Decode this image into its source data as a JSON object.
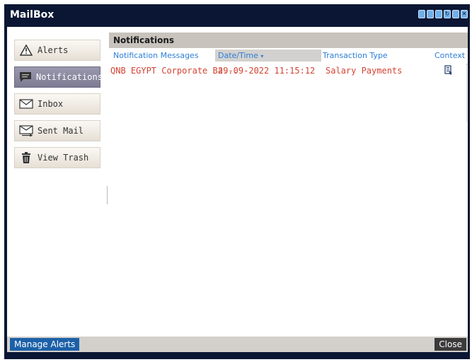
{
  "window": {
    "title": "MailBox"
  },
  "titlebar_icons": [
    "window-icon",
    "window-icon",
    "window-icon",
    "refresh-icon",
    "window-icon",
    "close-icon"
  ],
  "sidebar": {
    "items": [
      {
        "label": "Alerts",
        "icon": "warning-icon",
        "active": false
      },
      {
        "label": "Notifications",
        "icon": "message-icon",
        "active": true
      },
      {
        "label": "Inbox",
        "icon": "envelope-icon",
        "active": false
      },
      {
        "label": "Sent Mail",
        "icon": "sent-envelope-icon",
        "active": false
      },
      {
        "label": "View Trash",
        "icon": "trash-icon",
        "active": false
      }
    ]
  },
  "main": {
    "header": "Notifications",
    "columns": [
      "Notification Messages",
      "Date/Time",
      "Transaction Type",
      "Context"
    ],
    "rows": [
      {
        "message": "QNB EGYPT Corporate Ba...",
        "datetime": "29-09-2022 11:15:12",
        "type": "Salary Payments",
        "context_icon": "document-icon"
      }
    ]
  },
  "footer": {
    "manage_label": "Manage Alerts",
    "close_label": "Close"
  },
  "colors": {
    "frame": "#0a1633",
    "link": "#2c7fd6",
    "row_text": "#d44332",
    "active_nav": "#8a889f"
  }
}
